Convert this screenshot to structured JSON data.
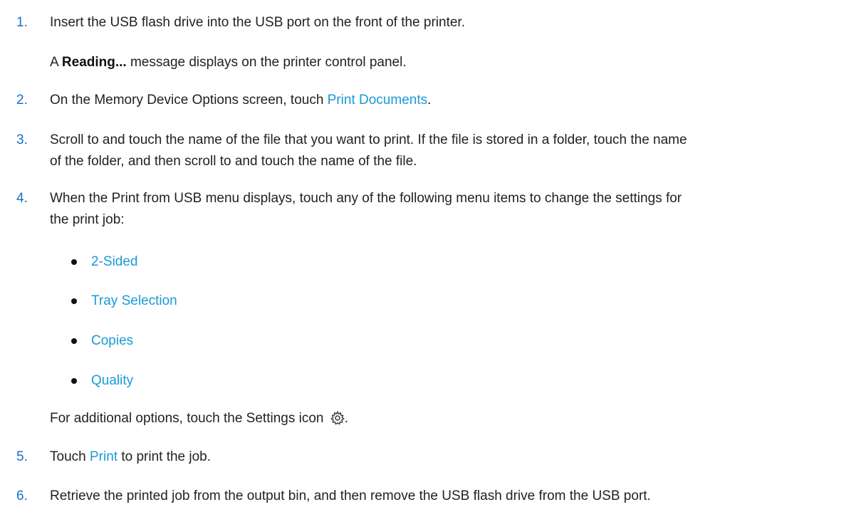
{
  "steps": [
    {
      "num": "1.",
      "text": "Insert the USB flash drive into the USB port on the front of the printer."
    },
    {
      "num": "2.",
      "pre": "On the Memory Device Options screen, touch ",
      "link": "Print Documents",
      "post": "."
    },
    {
      "num": "3.",
      "line1": "Scroll to and touch the name of the file that you want to print. If the file is stored in a folder, touch the name",
      "line2": "of the folder, and then scroll to and touch the name of the file."
    },
    {
      "num": "4.",
      "line1": "When the Print from USB menu displays, touch any of the following menu items to change the settings for",
      "line2": "the print job:"
    },
    {
      "num": "5.",
      "pre": "Touch ",
      "link": "Print",
      "post": " to print the job."
    },
    {
      "num": "6.",
      "text": "Retrieve the printed job from the output bin, and then remove the USB flash drive from the USB port."
    }
  ],
  "step1_note": {
    "pre": "A ",
    "bold": "Reading...",
    "post": " message displays on the printer control panel."
  },
  "step4_items": [
    "2-Sided",
    "Tray Selection",
    "Copies",
    "Quality"
  ],
  "step4_note": {
    "pre": "For additional options, touch the Settings icon",
    "post": "."
  },
  "icons": {
    "settings": "gear-icon"
  },
  "colors": {
    "number": "#1a6ec9",
    "link": "#1a9ad6",
    "text": "#222222"
  }
}
